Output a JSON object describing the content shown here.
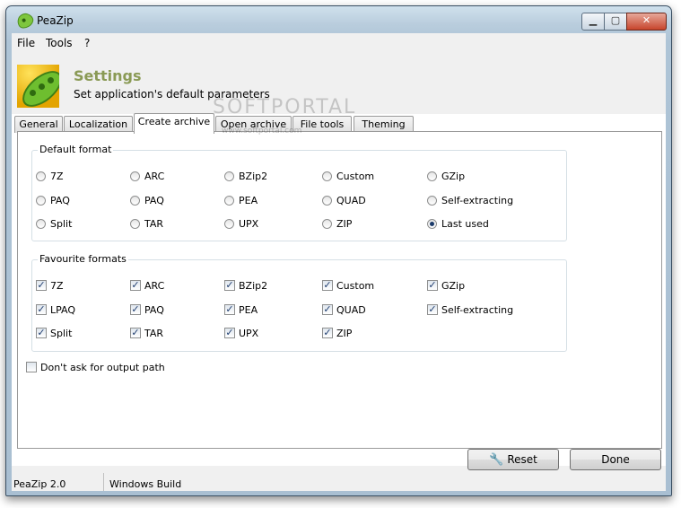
{
  "window": {
    "title": "PeaZip"
  },
  "menu": [
    "File",
    "Tools",
    "?"
  ],
  "header": {
    "title": "Settings",
    "subtitle": "Set application's default parameters"
  },
  "watermark": {
    "text": "SOFTPORTAL",
    "url": "www.softportal.com"
  },
  "tabs": [
    {
      "label": "General",
      "active": false
    },
    {
      "label": "Localization",
      "active": false
    },
    {
      "label": "Create archive",
      "active": true
    },
    {
      "label": "Open archive",
      "active": false
    },
    {
      "label": "File tools",
      "active": false
    },
    {
      "label": "Theming",
      "active": false
    }
  ],
  "default_format": {
    "label": "Default format",
    "selected": "Last used",
    "rows": [
      [
        "7Z",
        "ARC",
        "BZip2",
        "Custom",
        "GZip"
      ],
      [
        "PAQ",
        "PAQ",
        "PEA",
        "QUAD",
        "Self-extracting"
      ],
      [
        "Split",
        "TAR",
        "UPX",
        "ZIP",
        "Last used"
      ]
    ]
  },
  "favourite_formats": {
    "label": "Favourite formats",
    "rows": [
      [
        "7Z",
        "ARC",
        "BZip2",
        "Custom",
        "GZip"
      ],
      [
        "LPAQ",
        "PAQ",
        "PEA",
        "QUAD",
        "Self-extracting"
      ],
      [
        "Split",
        "TAR",
        "UPX",
        "ZIP"
      ]
    ],
    "checked": true
  },
  "dont_ask": {
    "label": "Don't ask for output path",
    "checked": false
  },
  "buttons": {
    "reset": "Reset",
    "done": "Done"
  },
  "status": {
    "version": "PeaZip 2.0",
    "build": "Windows Build"
  }
}
